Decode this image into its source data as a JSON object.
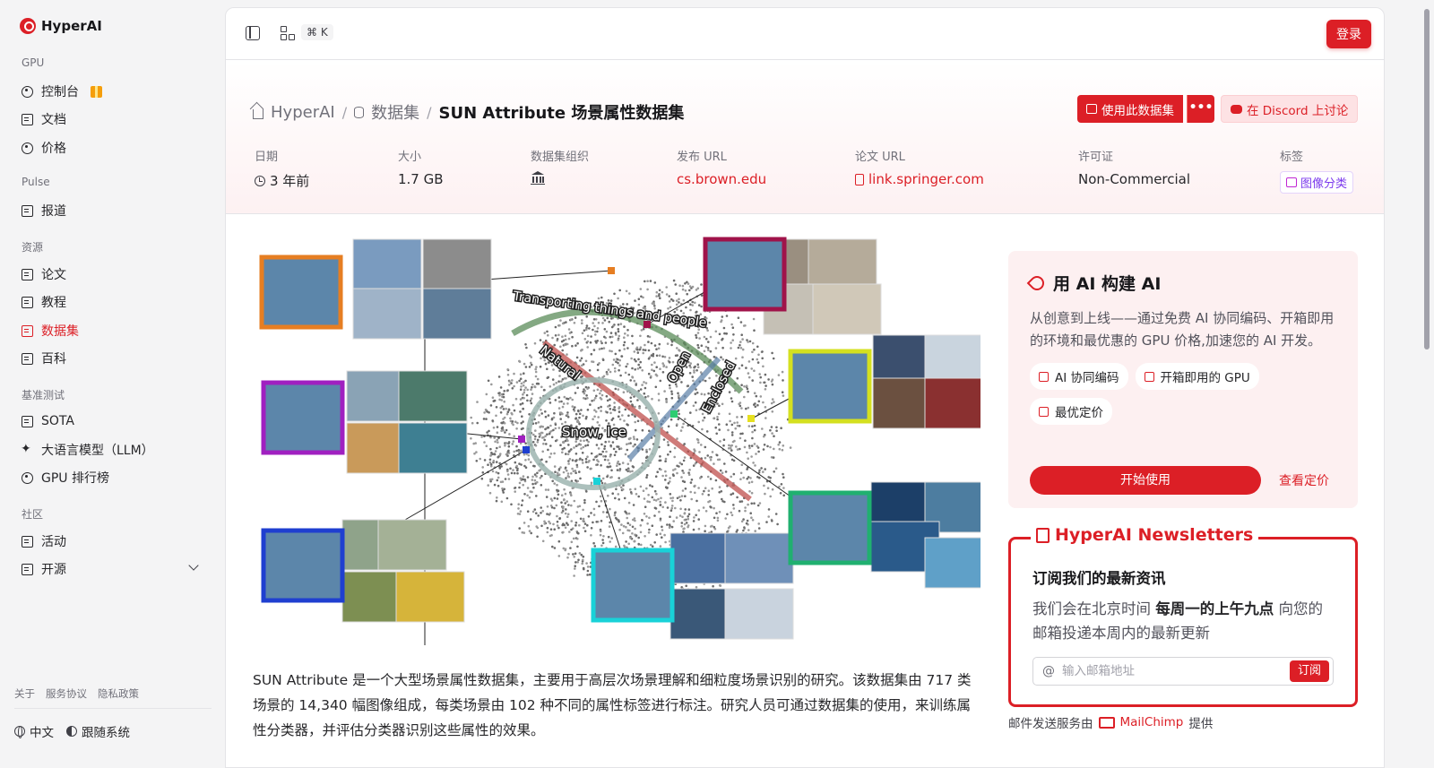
{
  "brand": {
    "name": "HyperAI"
  },
  "sidebar": {
    "sections": [
      {
        "label": "GPU",
        "items": [
          {
            "label": "控制台"
          },
          {
            "label": "文档"
          },
          {
            "label": "价格"
          }
        ]
      },
      {
        "label": "Pulse",
        "items": [
          {
            "label": "报道"
          }
        ]
      },
      {
        "label": "资源",
        "items": [
          {
            "label": "论文"
          },
          {
            "label": "教程"
          },
          {
            "label": "数据集",
            "active": true
          },
          {
            "label": "百科"
          }
        ]
      },
      {
        "label": "基准测试",
        "items": [
          {
            "label": "SOTA"
          },
          {
            "label": "大语言模型（LLM）"
          },
          {
            "label": "GPU 排行榜"
          }
        ]
      },
      {
        "label": "社区",
        "items": [
          {
            "label": "活动"
          },
          {
            "label": "开源"
          }
        ]
      }
    ],
    "footer_links": [
      "关于",
      "服务协议",
      "隐私政策"
    ],
    "language": "中文",
    "theme": "跟随系统"
  },
  "topbar": {
    "shortcut": "⌘ K",
    "login_label": "登录"
  },
  "breadcrumb": {
    "home": "HyperAI",
    "section": "数据集",
    "current": "SUN Attribute 场景属性数据集"
  },
  "actions": {
    "use_dataset": "使用此数据集",
    "more": "•••",
    "discord": "在 Discord 上讨论"
  },
  "meta": {
    "date_label": "日期",
    "date_value": "3 年前",
    "size_label": "大小",
    "size_value": "1.7 GB",
    "org_label": "数据集组织",
    "publish_url_label": "发布 URL",
    "publish_url_value": "cs.brown.edu",
    "paper_url_label": "论文 URL",
    "paper_url_value": "link.springer.com",
    "license_label": "许可证",
    "license_value": "Non-Commercial",
    "tags_label": "标签",
    "tag_value": "图像分类"
  },
  "hero_figure": {
    "labels": [
      "Transporting things and people",
      "Natural",
      "Open",
      "Enclosed",
      "Snow, Ice"
    ]
  },
  "description": "SUN Attribute 是一个大型场景属性数据集，主要用于高层次场景理解和细粒度场景识别的研究。该数据集由 717 类场景的 14,340 幅图像组成，每类场景由 102 种不同的属性标签进行标注。研究人员可通过数据集的使用，来训练属性分类器，并评估分类器识别这些属性的效果。",
  "promo": {
    "title": "用 AI 构建 AI",
    "text": "从创意到上线——通过免费 AI 协同编码、开箱即用的环境和最优惠的 GPU 价格,加速您的 AI 开发。",
    "chips": [
      "AI 协同编码",
      "开箱即用的 GPU",
      "最优定价"
    ],
    "start_label": "开始使用",
    "pricing_label": "查看定价"
  },
  "newsletter": {
    "title": "HyperAI Newsletters",
    "heading": "订阅我们的最新资讯",
    "text_before": "我们会在北京时间",
    "text_bold": "每周一的上午九点",
    "text_after": "向您的邮箱投递本周内的最新更新",
    "input_placeholder": "输入邮箱地址",
    "subscribe_label": "订阅"
  },
  "mail_credit": {
    "before": "邮件发送服务由",
    "provider": "MailChimp",
    "after": "提供"
  },
  "colors": {
    "accent": "#dc1f26",
    "header_tint": "#fdf1f2",
    "promo_bg": "#fdf0f1"
  }
}
